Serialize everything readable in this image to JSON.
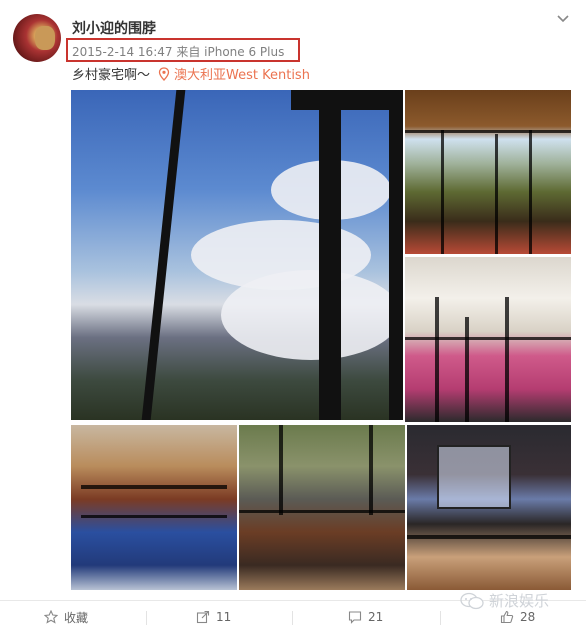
{
  "post": {
    "username": "刘小迎的围脖",
    "timestamp": "2015-2-14 16:47",
    "source": "来自 iPhone 6 Plus",
    "text": "乡村豪宅啊～",
    "location": "澳大利亚West Kentish",
    "accent_color": "#eb7350",
    "highlight_color": "#c9342e"
  },
  "actions": {
    "favorite": {
      "label": "收藏",
      "icon": "star-icon"
    },
    "repost": {
      "count": "11",
      "icon": "repost-icon"
    },
    "comment": {
      "count": "21",
      "icon": "comment-icon"
    },
    "like": {
      "count": "28",
      "icon": "thumbs-up-icon"
    }
  },
  "watermark": "新浪娱乐"
}
